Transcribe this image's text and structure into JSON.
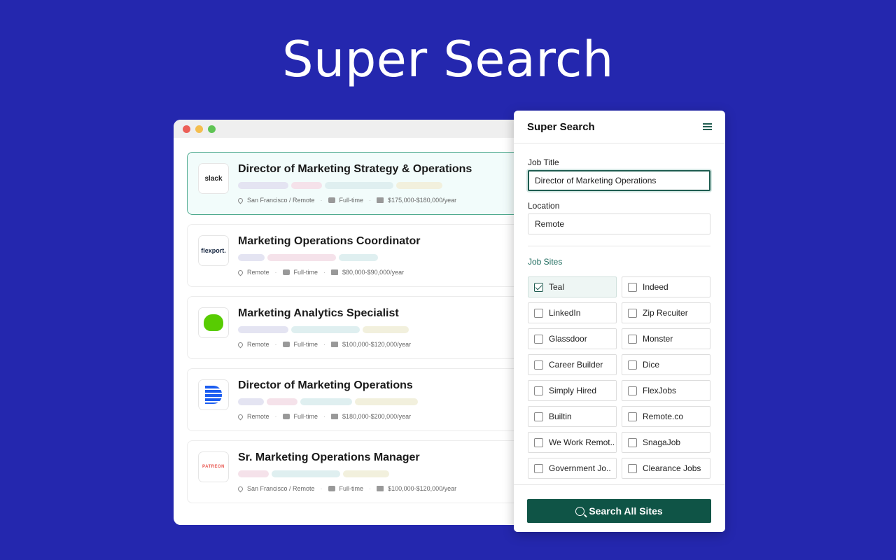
{
  "hero": {
    "title": "Super Search"
  },
  "browser": {
    "dots": [
      "#ec5f57",
      "#f4be4f",
      "#5fc454"
    ],
    "jobs": [
      {
        "title": "Director of Marketing Strategy & Operations",
        "logo": "slack",
        "location": "San Francisco / Remote",
        "type": "Full-time",
        "salary": "$175,000-$180,000/year",
        "selected": true,
        "tags": [
          [
            "#e4e4f2",
            72
          ],
          [
            "#f5e2ea",
            44
          ],
          [
            "#dfeff0",
            98
          ],
          [
            "#f2f0dd",
            66
          ]
        ]
      },
      {
        "title": "Marketing Operations Coordinator",
        "logo": "flexport.",
        "location": "Remote",
        "type": "Full-time",
        "salary": "$80,000-$90,000/year",
        "selected": false,
        "tags": [
          [
            "#e4e4f2",
            38
          ],
          [
            "#f5e2ea",
            98
          ],
          [
            "#dfeff0",
            56
          ]
        ]
      },
      {
        "title": "Marketing Analytics Specialist",
        "logo": "duolingo",
        "location": "Remote",
        "type": "Full-time",
        "salary": "$100,000-$120,000/year",
        "selected": false,
        "tags": [
          [
            "#e4e4f2",
            72
          ],
          [
            "#dfeff0",
            98
          ],
          [
            "#f2f0dd",
            66
          ]
        ]
      },
      {
        "title": "Director of Marketing Operations",
        "logo": "deel",
        "location": "Remote",
        "type": "Full-time",
        "salary": "$180,000-$200,000/year",
        "selected": false,
        "tags": [
          [
            "#e4e4f2",
            37
          ],
          [
            "#f5e2ea",
            44
          ],
          [
            "#dfeff0",
            74
          ],
          [
            "#f2f0dd",
            90
          ]
        ]
      },
      {
        "title": "Sr. Marketing Operations Manager",
        "logo": "PATREON",
        "location": "San Francisco / Remote",
        "type": "Full-time",
        "salary": "$100,000-$120,000/year",
        "selected": false,
        "tags": [
          [
            "#f5e2ea",
            44
          ],
          [
            "#dfeff0",
            98
          ],
          [
            "#f2f0dd",
            66
          ]
        ]
      }
    ]
  },
  "panel": {
    "title": "Super Search",
    "job_title_label": "Job Title",
    "job_title_value": "Director of Marketing Operations",
    "location_label": "Location",
    "location_value": "Remote",
    "sites_label": "Job Sites",
    "sites": [
      {
        "label": "Teal",
        "checked": true
      },
      {
        "label": "Indeed",
        "checked": false
      },
      {
        "label": "LinkedIn",
        "checked": false
      },
      {
        "label": "Zip Recuiter",
        "checked": false
      },
      {
        "label": "Glassdoor",
        "checked": false
      },
      {
        "label": "Monster",
        "checked": false
      },
      {
        "label": "Career Builder",
        "checked": false
      },
      {
        "label": "Dice",
        "checked": false
      },
      {
        "label": "Simply Hired",
        "checked": false
      },
      {
        "label": "FlexJobs",
        "checked": false
      },
      {
        "label": "Builtin",
        "checked": false
      },
      {
        "label": "Remote.co",
        "checked": false
      },
      {
        "label": "We Work Remot..",
        "checked": false
      },
      {
        "label": "SnagaJob",
        "checked": false
      },
      {
        "label": "Government Jo..",
        "checked": false
      },
      {
        "label": "Clearance Jobs",
        "checked": false
      }
    ],
    "search_button": "Search All Sites"
  },
  "colors": {
    "background": "#2427ae",
    "accent": "#0f5446",
    "selected_border": "#4eaa8e"
  }
}
